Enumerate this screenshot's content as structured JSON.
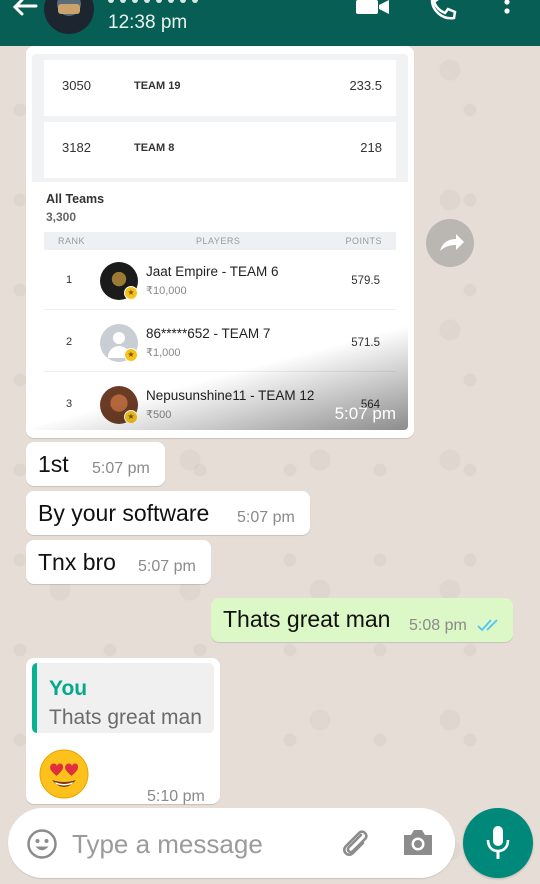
{
  "header": {
    "last_seen": "12:38 pm",
    "icons": [
      "back-arrow-icon",
      "video-call-icon",
      "phone-icon",
      "more-vert-icon"
    ]
  },
  "shared_image": {
    "top_rows": [
      {
        "rank": "3050",
        "team": "TEAM 19",
        "points": "233.5"
      },
      {
        "rank": "3182",
        "team": "TEAM 8",
        "points": "218"
      }
    ],
    "all_teams_title": "All Teams",
    "all_teams_count": "3,300",
    "col_rank": "RANK",
    "col_players": "PLAYERS",
    "col_points": "POINTS",
    "players": [
      {
        "rank": "1",
        "name": "Jaat Empire - TEAM 6",
        "amount": "₹10,000",
        "points": "579.5"
      },
      {
        "rank": "2",
        "name": "86*****652 - TEAM 7",
        "amount": "₹1,000",
        "points": "571.5"
      },
      {
        "rank": "3",
        "name": "Nepusunshine11 - TEAM 12",
        "amount": "₹500",
        "points": "564"
      }
    ],
    "time": "5:07 pm"
  },
  "messages": [
    {
      "text": "1st",
      "time": "5:07 pm",
      "direction": "in"
    },
    {
      "text": "By your software",
      "time": "5:07 pm",
      "direction": "in"
    },
    {
      "text": "Tnx bro",
      "time": "5:07 pm",
      "direction": "in"
    },
    {
      "text": "Thats great man",
      "time": "5:08 pm",
      "direction": "out",
      "status": "read"
    }
  ],
  "reply": {
    "quoted_author": "You",
    "quoted_text": "Thats great man",
    "body_emoji": "smiling-face-with-heart-eyes",
    "time": "5:10 pm"
  },
  "composer": {
    "placeholder": "Type a message"
  },
  "colors": {
    "header": "#075e54",
    "outgoing_bubble": "#dcf8c6",
    "accent": "#00897b",
    "read_ticks": "#4fc3f7",
    "quote_bar": "#06b28f"
  }
}
